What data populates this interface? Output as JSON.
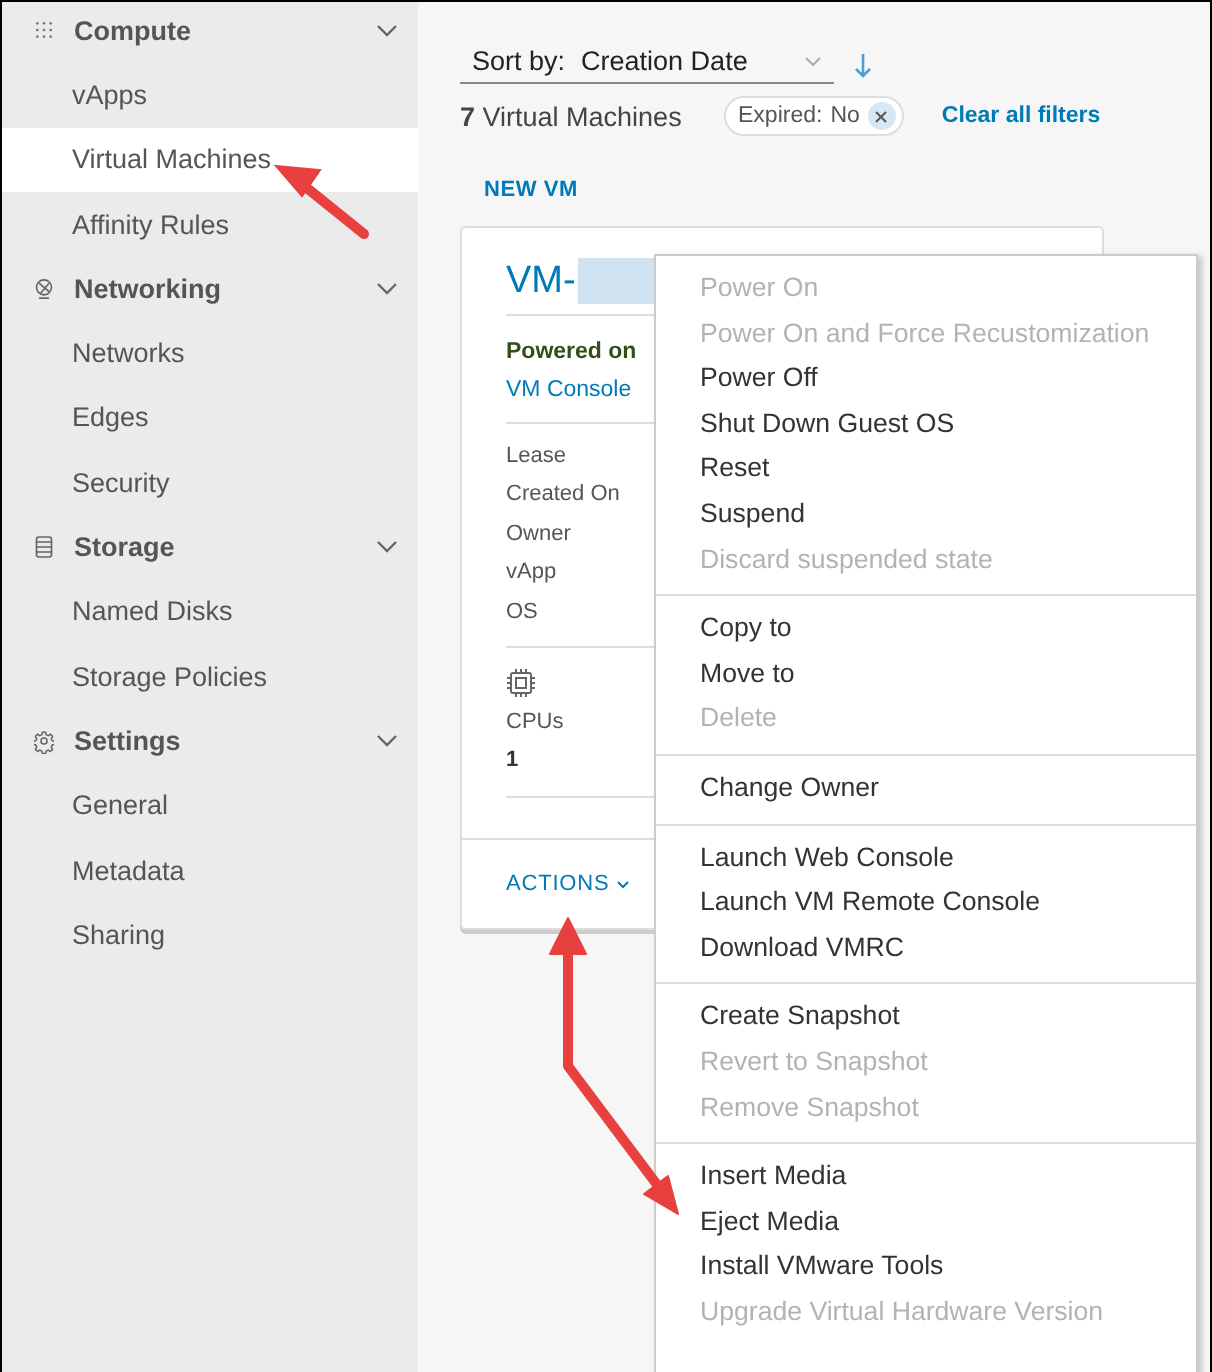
{
  "sidebar": {
    "groups": [
      {
        "label": "Compute",
        "expanded": true,
        "items": [
          {
            "label": "vApps",
            "selected": false
          },
          {
            "label": "Virtual Machines",
            "selected": true
          },
          {
            "label": "Affinity Rules",
            "selected": false
          }
        ]
      },
      {
        "label": "Networking",
        "expanded": true,
        "items": [
          {
            "label": "Networks",
            "selected": false
          },
          {
            "label": "Edges",
            "selected": false
          },
          {
            "label": "Security",
            "selected": false
          }
        ]
      },
      {
        "label": "Storage",
        "expanded": true,
        "items": [
          {
            "label": "Named Disks",
            "selected": false
          },
          {
            "label": "Storage Policies",
            "selected": false
          }
        ]
      },
      {
        "label": "Settings",
        "expanded": true,
        "items": [
          {
            "label": "General",
            "selected": false
          },
          {
            "label": "Metadata",
            "selected": false
          },
          {
            "label": "Sharing",
            "selected": false
          }
        ]
      }
    ]
  },
  "toolbar": {
    "sort_label": "Sort by:",
    "sort_value": "Creation Date",
    "count": "**7** Virtual Machines",
    "filter": {
      "label": "Expired:",
      "value": "No"
    },
    "clear_filters": "Clear all filters",
    "new_button": "NEW VM"
  },
  "card": {
    "title": "VM-",
    "status": "Powered on",
    "console_link": "VM Console",
    "fields": [
      "Lease",
      "Created On",
      "Owner",
      "vApp",
      "OS"
    ],
    "stat": {
      "label": "CPUs",
      "value": "1"
    },
    "actions": "ACTIONS"
  },
  "menu": {
    "sections": [
      [
        {
          "label": "Power On",
          "disabled": true
        },
        {
          "label": "Power On and Force Recustomization",
          "disabled": true
        },
        {
          "label": "Power Off",
          "disabled": false
        },
        {
          "label": "Shut Down Guest OS",
          "disabled": false
        },
        {
          "label": "Reset",
          "disabled": false
        },
        {
          "label": "Suspend",
          "disabled": false
        },
        {
          "label": "Discard suspended state",
          "disabled": true
        }
      ],
      [
        {
          "label": "Copy to",
          "disabled": false
        },
        {
          "label": "Move to",
          "disabled": false
        },
        {
          "label": "Delete",
          "disabled": true
        }
      ],
      [
        {
          "label": "Change Owner",
          "disabled": false
        }
      ],
      [
        {
          "label": "Launch Web Console",
          "disabled": false
        },
        {
          "label": "Launch VM Remote Console",
          "disabled": false
        },
        {
          "label": "Download VMRC",
          "disabled": false
        }
      ],
      [
        {
          "label": "Create Snapshot",
          "disabled": false
        },
        {
          "label": "Revert to Snapshot",
          "disabled": true
        },
        {
          "label": "Remove Snapshot",
          "disabled": true
        }
      ],
      [
        {
          "label": "Insert Media",
          "disabled": false
        },
        {
          "label": "Eject Media",
          "disabled": false
        },
        {
          "label": "Install VMware Tools",
          "disabled": false
        },
        {
          "label": "Upgrade Virtual Hardware Version",
          "disabled": true
        }
      ]
    ]
  }
}
